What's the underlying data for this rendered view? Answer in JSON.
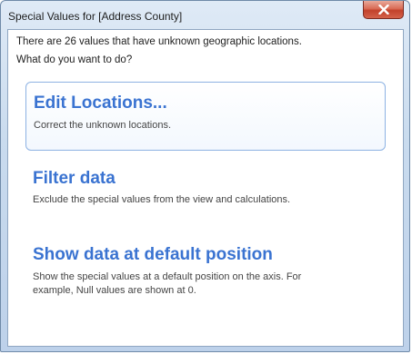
{
  "window": {
    "title": "Special Values for [Address County]"
  },
  "message": {
    "line1": "There are 26 values that have unknown geographic locations.",
    "line2": "What do you want to do?"
  },
  "options": [
    {
      "title": "Edit Locations...",
      "description": "Correct the unknown locations."
    },
    {
      "title": "Filter data",
      "description": "Exclude the special values from the view and calculations."
    },
    {
      "title": "Show data at default position",
      "description_line1": "Show the special values at a default position on the axis. For",
      "description_line2": "example, Null values are shown at 0."
    }
  ],
  "icons": {
    "close": "close-icon"
  }
}
